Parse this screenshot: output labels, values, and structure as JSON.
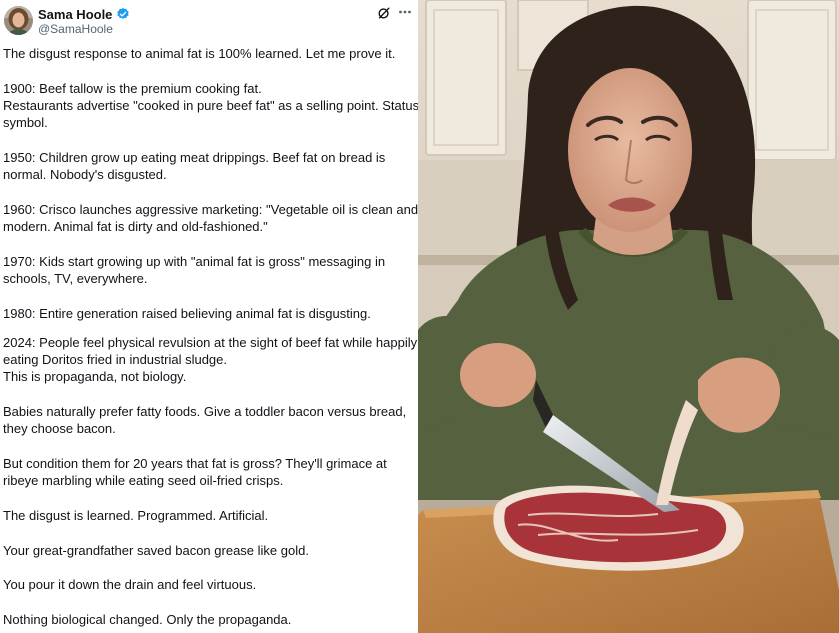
{
  "author": {
    "display_name": "Sama Hoole",
    "handle": "@SamaHoole",
    "avatar_icon": "profile-photo",
    "verified_icon": "verified-badge-icon"
  },
  "toolbar": {
    "grok_icon": "grok-icon",
    "more_icon": "more-options-icon"
  },
  "tweet": {
    "lines": [
      "The disgust response to animal fat is 100% learned. Let me prove it.",
      "1900: Beef tallow is the premium cooking fat.",
      "Restaurants advertise \"cooked in pure beef fat\" as a selling point. Status",
      "symbol.",
      "1950: Children grow up eating meat drippings. Beef fat on bread is",
      "normal. Nobody's disgusted.",
      "1960: Crisco launches aggressive marketing: \"Vegetable oil is clean and",
      "modern. Animal fat is dirty and old-fashioned.\"",
      "1970: Kids start growing up with \"animal fat is gross\" messaging in",
      "schools, TV, everywhere.",
      "1980: Entire generation raised believing animal fat is disgusting.",
      "2024: People feel physical revulsion at the sight of beef fat while happily",
      "eating Doritos fried in industrial sludge.",
      "This is propaganda, not biology.",
      "Babies naturally prefer fatty foods. Give a toddler bacon versus bread,",
      "they choose bacon.",
      "But condition them for 20 years that fat is gross? They'll grimace at",
      "ribeye marbling while eating seed oil-fried crisps.",
      "The disgust is learned. Programmed. Artificial.",
      "Your great-grandfather saved bacon grease like gold.",
      "You pour it down the drain and feel virtuous.",
      "Nothing biological changed. Only the propaganda."
    ]
  },
  "media": {
    "subject": "woman grimacing while cutting raw steak fat in a kitchen"
  },
  "colors": {
    "text": "#0f1419",
    "secondary_text": "#536471",
    "verified_blue": "#1d9bf0"
  }
}
